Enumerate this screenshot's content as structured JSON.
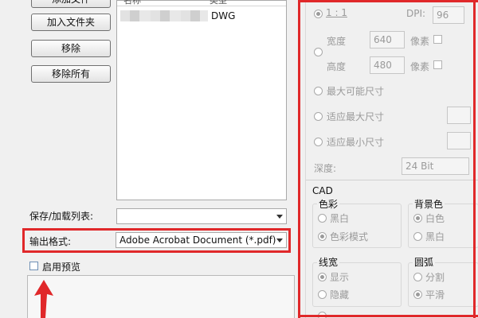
{
  "left": {
    "top_button_partial": "添加文件",
    "buttons": {
      "add_folder": "加入文件夹",
      "remove": "移除",
      "remove_all": "移除所有"
    },
    "list": {
      "header_name": "名称",
      "header_type": "类型",
      "row_type": "DWG"
    },
    "save_load_label": "保存/加载列表:",
    "save_load_value": "",
    "output_format_label": "输出格式:",
    "output_format_value": "Adobe Acrobat Document (*.pdf)",
    "preview_label": "启用预览"
  },
  "right": {
    "ratio_label": "1 : 1",
    "dpi_label": "DPI:",
    "dpi_value": "96",
    "width_label": "宽度",
    "width_value": "640",
    "width_unit": "像素",
    "height_label": "高度",
    "height_value": "480",
    "height_unit": "像素",
    "max_size": "最大可能尺寸",
    "fit_max": "适应最大尺寸",
    "fit_min": "适应最小尺寸",
    "depth_label": "深度:",
    "depth_value": "24 Bit",
    "cad_title": "CAD",
    "color_group": "色彩",
    "color_black": "黑白",
    "color_mode": "色彩模式",
    "bg_group": "背景色",
    "bg_white": "白色",
    "bg_black": "黑白",
    "linewidth_group": "线宽",
    "lw_show": "显示",
    "lw_hide": "隐藏",
    "arc_group": "圆弧",
    "arc_split": "分割",
    "arc_smooth": "平滑"
  }
}
